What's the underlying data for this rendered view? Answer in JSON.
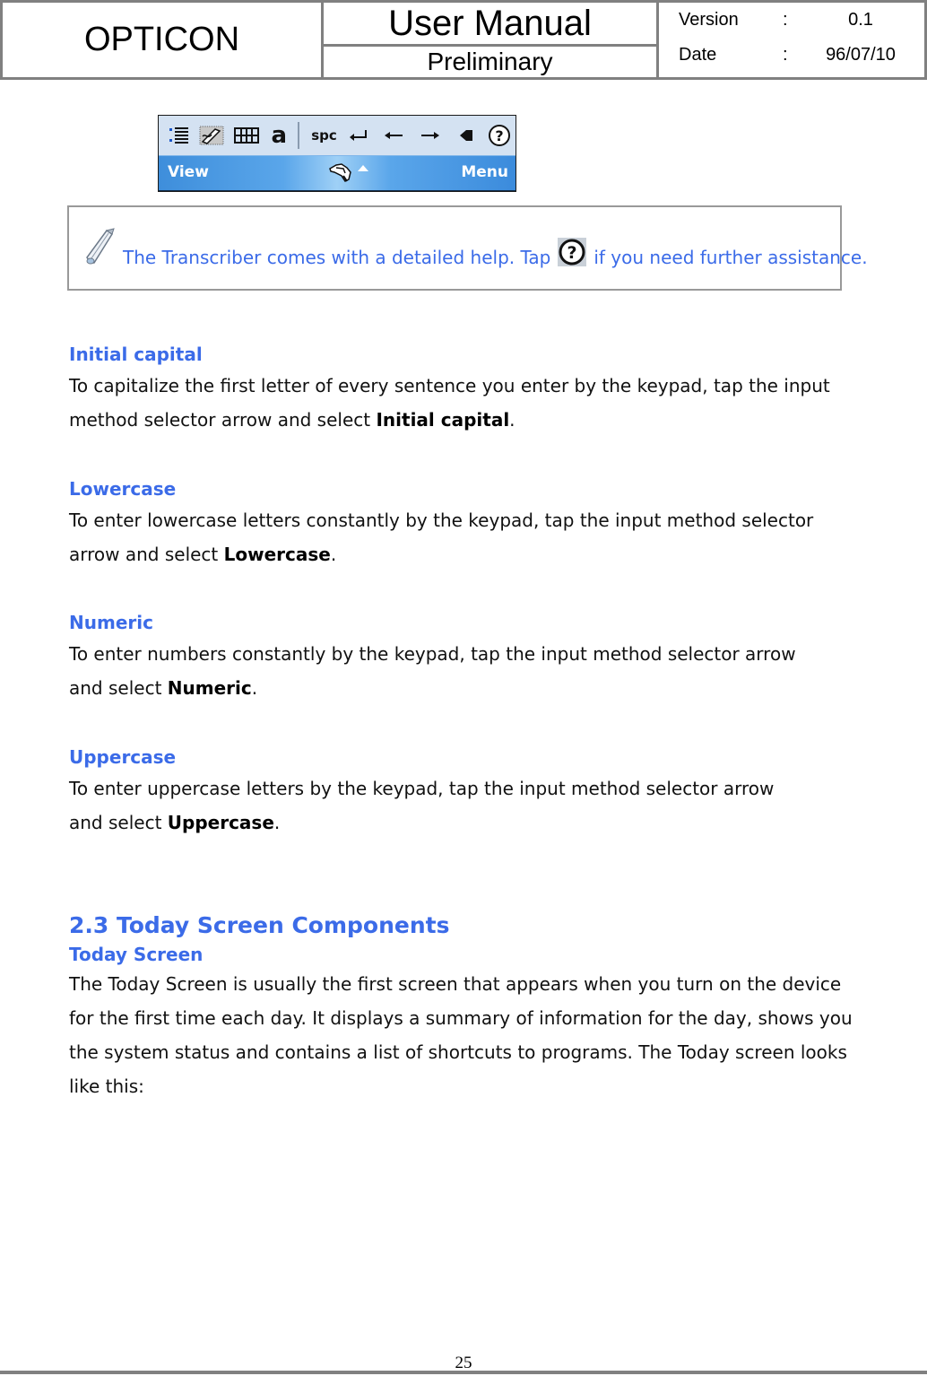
{
  "header": {
    "company": "OPTICON",
    "title": "User Manual",
    "subtitle": "Preliminary",
    "version_label": "Version",
    "version_value": "0.1",
    "date_label": "Date",
    "date_value": "96/07/10",
    "separator": ":"
  },
  "toolbar_image": {
    "buttons": [
      {
        "icon": "list-icon",
        "glyph": "⁝≣"
      },
      {
        "icon": "handwriting-icon",
        "glyph": "✍"
      },
      {
        "icon": "keyboard-grid-icon",
        "glyph": "⌨"
      },
      {
        "icon": "letter-a-icon",
        "glyph": "a"
      },
      {
        "icon": "space-icon",
        "glyph": "spc"
      },
      {
        "icon": "enter-icon",
        "glyph": "↵"
      },
      {
        "icon": "arrow-left-icon",
        "glyph": "←"
      },
      {
        "icon": "arrow-right-icon",
        "glyph": "→"
      },
      {
        "icon": "backspace-icon",
        "glyph": "◆"
      },
      {
        "icon": "help-icon",
        "glyph": "?"
      }
    ],
    "menubar": {
      "left": "View",
      "right": "Menu"
    }
  },
  "note": {
    "text_before": "The Transcriber comes with a detailed help. Tap",
    "text_after": "if you need further assistance."
  },
  "sections": [
    {
      "heading": "Initial capital",
      "text": "To capitalize the first letter of every sentence you enter by the keypad, tap the input method selector arrow and select ",
      "bold": "Initial capital",
      "end": "."
    },
    {
      "heading": "Lowercase",
      "text": "To enter lowercase letters constantly by the keypad, tap the input method selector arrow and select ",
      "bold": "Lowercase",
      "end": "."
    },
    {
      "heading": "Numeric",
      "text": "To enter numbers constantly by the keypad, tap the input method selector arrow and select ",
      "bold": "Numeric",
      "end": "."
    },
    {
      "heading": "Uppercase",
      "text": "To enter uppercase letters by the keypad, tap the input method selector arrow and select ",
      "bold": "Uppercase",
      "end": "."
    }
  ],
  "section_23": {
    "title": "2.3 Today Screen Components",
    "subheading": "Today Screen",
    "text": "The Today Screen is usually the first screen that appears when you turn on the device for the first time each day. It displays a summary of information for the day, shows you the system status and contains a list of shortcuts to programs. The Today screen looks like this:"
  },
  "footer": {
    "page_number": "25"
  },
  "colors": {
    "heading_blue": "#3b6be8",
    "border_gray": "#808080",
    "menubar_blue": "#3e8edb"
  }
}
